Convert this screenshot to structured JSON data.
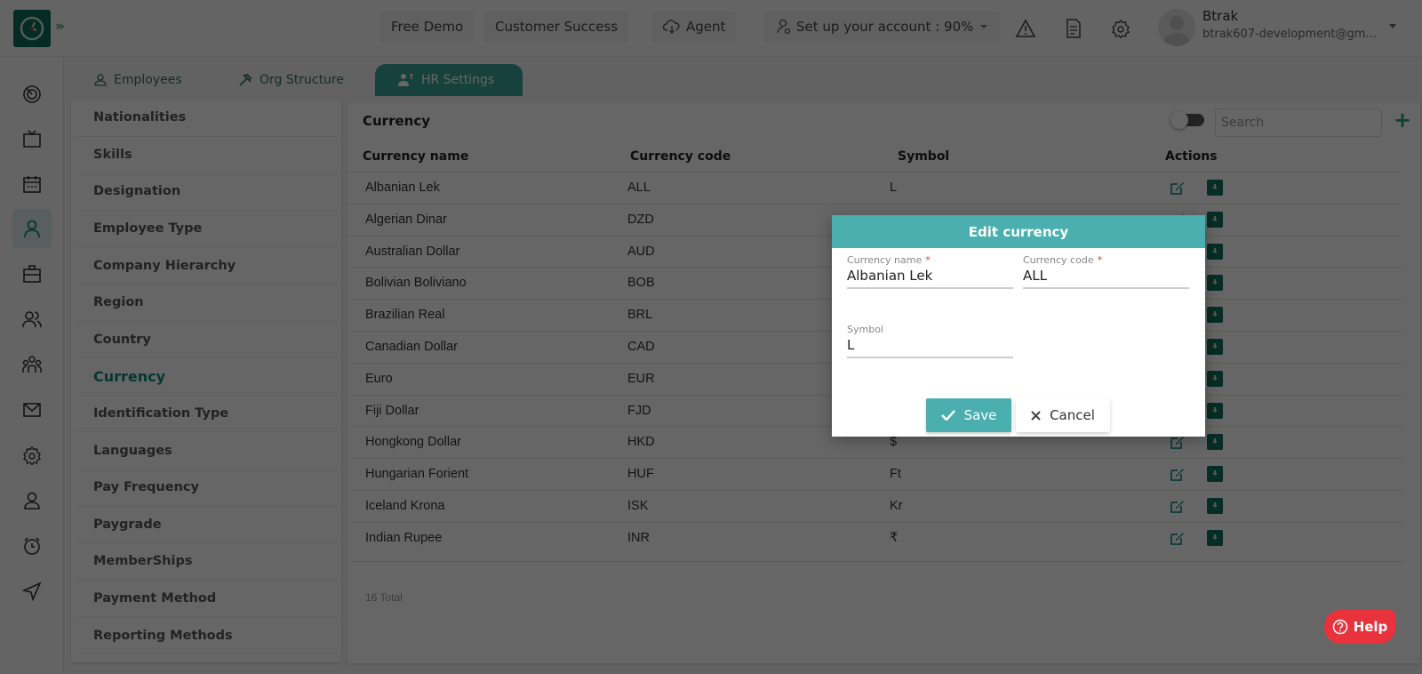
{
  "app": {
    "logo_icon": "clock-icon",
    "expand_icon": "triple-chevron-right-icon"
  },
  "topbar": {
    "free_demo": "Free Demo",
    "customer_success": "Customer Success",
    "agent": "Agent",
    "agent_icon": "cloud-download-icon",
    "setup_account": "Set up your account : 90%",
    "setup_icon": "user-setup-icon",
    "icons": [
      "warning-icon",
      "document-icon",
      "gear-icon"
    ],
    "user": {
      "name": "Btrak",
      "email": "btrak607-development@gm..."
    }
  },
  "rail": {
    "items": [
      {
        "icon": "dashboard-icon",
        "active": false
      },
      {
        "icon": "tv-icon",
        "active": false
      },
      {
        "icon": "calendar-icon",
        "active": false
      },
      {
        "icon": "user-icon",
        "active": true
      },
      {
        "icon": "briefcase-icon",
        "active": false
      },
      {
        "icon": "users-icon",
        "active": false
      },
      {
        "icon": "team-icon",
        "active": false
      },
      {
        "icon": "mail-icon",
        "active": false
      },
      {
        "icon": "settings-icon",
        "active": false
      },
      {
        "icon": "profile-icon",
        "active": false
      },
      {
        "icon": "alarm-icon",
        "active": false
      },
      {
        "icon": "send-icon",
        "active": false
      }
    ]
  },
  "tabs": [
    {
      "label": "Employees",
      "icon": "person-icon",
      "active": false
    },
    {
      "label": "Org Structure",
      "icon": "tools-icon",
      "active": false
    },
    {
      "label": "HR Settings",
      "icon": "hr-settings-icon",
      "active": true
    }
  ],
  "side_menu": {
    "items": [
      "Nationalities",
      "Skills",
      "Designation",
      "Employee Type",
      "Company Hierarchy",
      "Region",
      "Country",
      "Currency",
      "Identification Type",
      "Languages",
      "Pay Frequency",
      "Paygrade",
      "MemberShips",
      "Payment Method",
      "Reporting Methods"
    ],
    "active": "Currency"
  },
  "currency_panel": {
    "title": "Currency",
    "search_placeholder": "Search",
    "add_label": "+",
    "columns": [
      "Currency name",
      "Currency code",
      "Symbol",
      "Actions"
    ],
    "rows": [
      {
        "name": "Albanian Lek",
        "code": "ALL",
        "symbol": "L"
      },
      {
        "name": "Algerian Dinar",
        "code": "DZD",
        "symbol": ""
      },
      {
        "name": "Australian Dollar",
        "code": "AUD",
        "symbol": ""
      },
      {
        "name": "Bolivian Boliviano",
        "code": "BOB",
        "symbol": ""
      },
      {
        "name": "Brazilian Real",
        "code": "BRL",
        "symbol": ""
      },
      {
        "name": "Canadian Dollar",
        "code": "CAD",
        "symbol": ""
      },
      {
        "name": "Euro",
        "code": "EUR",
        "symbol": ""
      },
      {
        "name": "Fiji Dollar",
        "code": "FJD",
        "symbol": ""
      },
      {
        "name": "Hongkong Dollar",
        "code": "HKD",
        "symbol": "$"
      },
      {
        "name": "Hungarian Forient",
        "code": "HUF",
        "symbol": "Ft"
      },
      {
        "name": "Iceland Krona",
        "code": "ISK",
        "symbol": "Kr"
      },
      {
        "name": "Indian Rupee",
        "code": "INR",
        "symbol": "₹"
      }
    ],
    "total": "16 Total"
  },
  "modal": {
    "title": "Edit currency",
    "currency_name_label": "Currency name",
    "currency_name_value": "Albanian Lek",
    "currency_code_label": "Currency code",
    "currency_code_value": "ALL",
    "symbol_label": "Symbol",
    "symbol_value": "L",
    "required_mark": "*",
    "save_label": "Save",
    "cancel_label": "Cancel"
  },
  "help": {
    "label": "Help"
  },
  "colors": {
    "brand": "#0d6b5e",
    "accent": "#4aafae",
    "active_text": "#0f8a7a",
    "help": "#e8323c"
  }
}
